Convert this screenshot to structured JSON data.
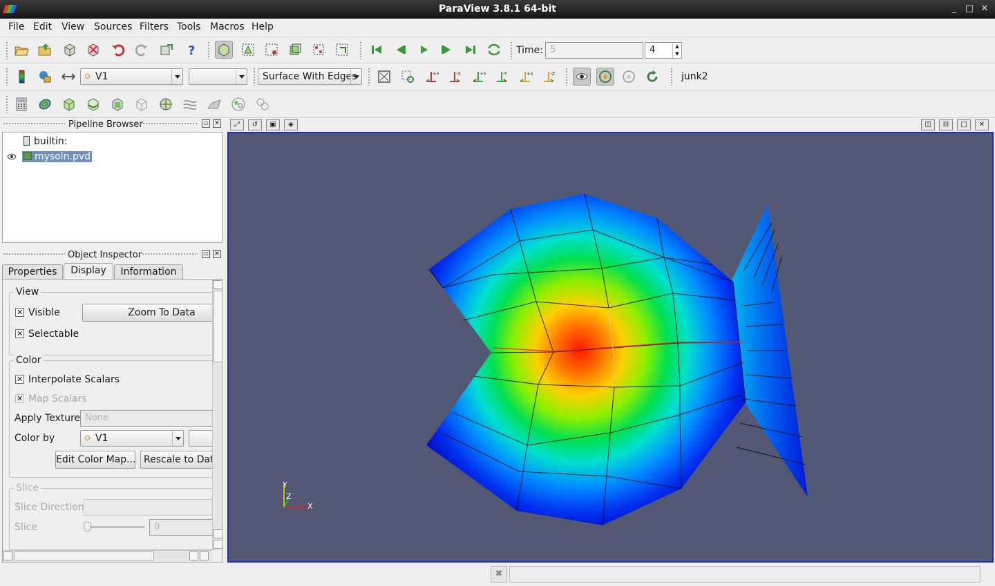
{
  "window": {
    "title": "ParaView 3.8.1 64-bit"
  },
  "menu": [
    "File",
    "Edit",
    "View",
    "Sources",
    "Filters",
    "Tools",
    "Macros",
    "Help"
  ],
  "time": {
    "label": "Time:",
    "value": "5",
    "step": "4"
  },
  "variable_toolbar": {
    "variable": "V1",
    "component": "",
    "representation": "Surface With Edges",
    "name_label": "junk2"
  },
  "pipeline": {
    "title": "Pipeline Browser",
    "items": [
      "builtin:",
      "mysoln.pvd"
    ]
  },
  "inspector": {
    "title": "Object Inspector",
    "tabs": [
      "Properties",
      "Display",
      "Information"
    ],
    "view_group": "View",
    "visible": "Visible",
    "selectable": "Selectable",
    "zoom_to_data": "Zoom To Data",
    "color_group": "Color",
    "interpolate_scalars": "Interpolate Scalars",
    "map_scalars": "Map Scalars",
    "apply_texture": "Apply Texture",
    "texture_value": "None",
    "color_by": "Color by",
    "color_by_value": "V1",
    "edit_color_map": "Edit Color Map...",
    "rescale": "Rescale to Data",
    "slice_group": "Slice",
    "slice_direction": "Slice Direction",
    "slice": "Slice",
    "slice_value": "0"
  },
  "axes": {
    "x": "X",
    "y": "Y",
    "z": "Z"
  },
  "colors": {
    "background": "#525773",
    "view_border": "#1a2bd6",
    "selection": "#6f8fbf"
  }
}
